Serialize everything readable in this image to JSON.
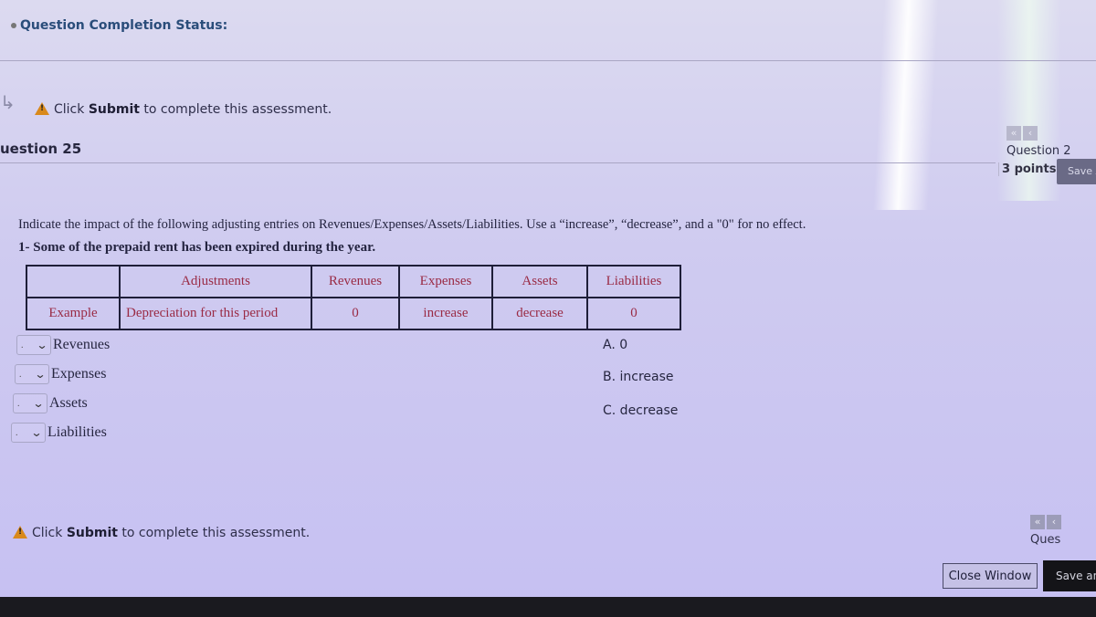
{
  "header": {
    "completion_status_label": "Question Completion Status:"
  },
  "notice": {
    "prefix": "Click ",
    "bold": "Submit",
    "suffix": " to complete this assessment."
  },
  "question": {
    "title": "uestion 25",
    "points": "3 points",
    "save_answer_label": "Save A",
    "prompt": "Indicate the impact of the following adjusting entries on Revenues/Expenses/Assets/Liabilities. Use a “increase”, “decrease”, and a \"0\" for no effect.",
    "subquestion": "1- Some of the prepaid rent has been expired during the year.",
    "example_table": {
      "headers": [
        "",
        "Adjustments",
        "Revenues",
        "Expenses",
        "Assets",
        "Liabilities"
      ],
      "row": [
        "Example",
        "Depreciation for this period",
        "0",
        "increase",
        "decrease",
        "0"
      ]
    },
    "dropdowns": [
      {
        "selected": ".",
        "label": "Revenues"
      },
      {
        "selected": ".",
        "label": "Expenses"
      },
      {
        "selected": ".",
        "label": "Assets"
      },
      {
        "selected": ".",
        "label": "Liabilities"
      }
    ],
    "options": [
      "A. 0",
      "B. increase",
      "C. decrease"
    ]
  },
  "navigation": {
    "top_label": "Question 2",
    "bottom_label": "Ques",
    "first_icon": "double-chevron-left-icon",
    "prev_icon": "chevron-left-icon"
  },
  "footer": {
    "close_window_label": "Close Window",
    "save_and_submit_label": "Save an"
  }
}
